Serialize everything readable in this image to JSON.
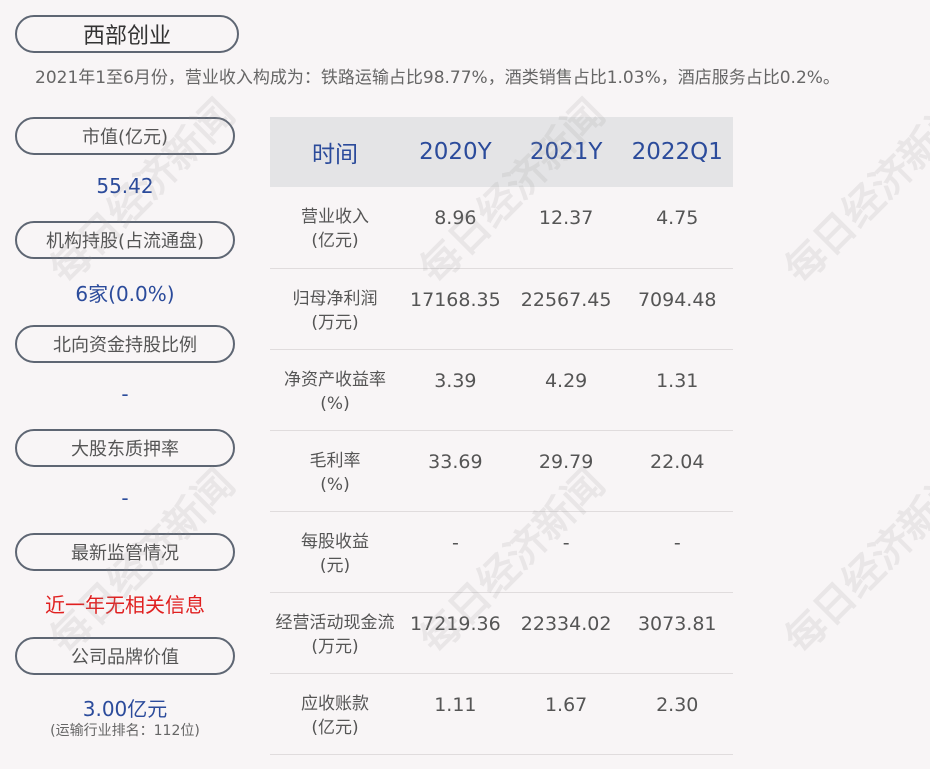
{
  "title": "西部创业",
  "summary": "2021年1至6月份，营业收入构成为：铁路运输占比98.77%，酒类销售占比1.03%，酒店服务占比0.2%。",
  "left": {
    "market_cap_label": "市值(亿元)",
    "market_cap": "55.42",
    "inst_label": "机构持股(占流通盘)",
    "inst": "6家(0.0%)",
    "north_label": "北向资金持股比例",
    "north": "-",
    "pledge_label": "大股东质押率",
    "pledge": "-",
    "reg_label": "最新监管情况",
    "reg": "近一年无相关信息",
    "brand_label": "公司品牌价值",
    "brand": "3.00亿元",
    "brand_rank": "(运输行业排名：112位)"
  },
  "table": {
    "headers": [
      "时间",
      "2020Y",
      "2021Y",
      "2022Q1"
    ],
    "rows": [
      {
        "l1": "营业收入",
        "l2": "(亿元)",
        "v": [
          "8.96",
          "12.37",
          "4.75"
        ]
      },
      {
        "l1": "归母净利润",
        "l2": "(万元)",
        "v": [
          "17168.35",
          "22567.45",
          "7094.48"
        ]
      },
      {
        "l1": "净资产收益率",
        "l2": "(%)",
        "v": [
          "3.39",
          "4.29",
          "1.31"
        ]
      },
      {
        "l1": "毛利率",
        "l2": "(%)",
        "v": [
          "33.69",
          "29.79",
          "22.04"
        ]
      },
      {
        "l1": "每股收益",
        "l2": "(元)",
        "v": [
          "-",
          "-",
          "-"
        ]
      },
      {
        "l1": "经营活动现金流",
        "l2": "(万元)",
        "v": [
          "17219.36",
          "22334.02",
          "3073.81"
        ]
      },
      {
        "l1": "应收账款",
        "l2": "(亿元)",
        "v": [
          "1.11",
          "1.67",
          "2.30"
        ]
      }
    ]
  },
  "watermark": "每日经济新闻"
}
